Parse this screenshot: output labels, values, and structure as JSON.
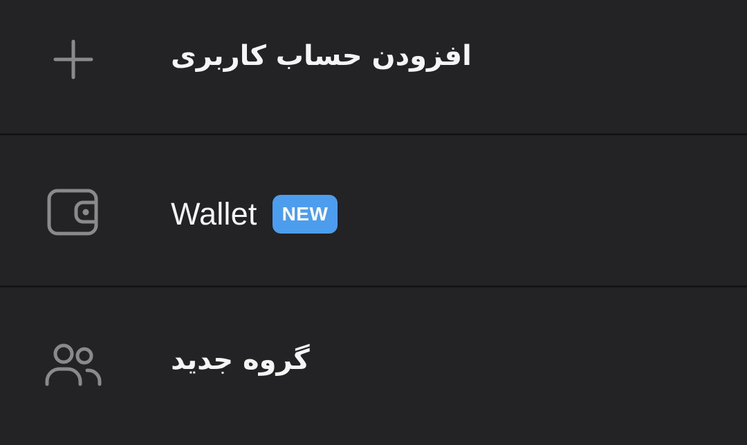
{
  "menu": {
    "items": [
      {
        "label": "افزودن حساب کاربری",
        "icon": "plus-icon"
      },
      {
        "label": "Wallet",
        "badge": "NEW",
        "icon": "wallet-icon"
      },
      {
        "label": "گروه جدید",
        "icon": "group-icon"
      }
    ]
  },
  "colors": {
    "background": "#232325",
    "divider": "#141416",
    "text": "#f5f5f5",
    "icon": "#8a8a8c",
    "badge": "#4c9dee"
  }
}
